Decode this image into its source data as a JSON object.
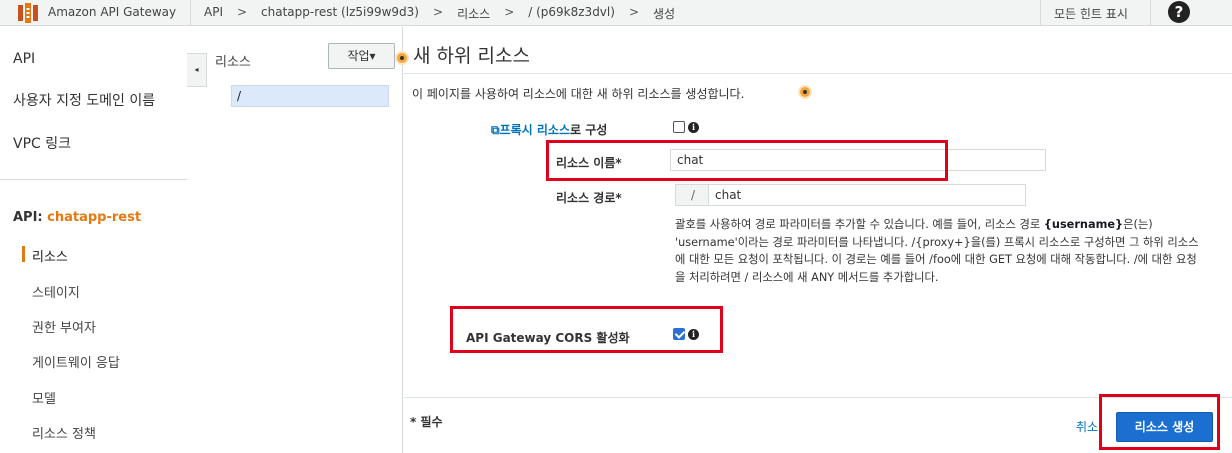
{
  "topbar": {
    "brand": "Amazon API Gateway",
    "breadcrumbs": [
      "API",
      "chatapp-rest (lz5i99w9d3)",
      "리소스",
      "/ (p69k8z3dvl)",
      "생성"
    ],
    "separator": ">",
    "hints_label": "모든 힌트 표시",
    "help_label": "?"
  },
  "leftnav": {
    "items": [
      "API",
      "사용자 지정 도메인 이름",
      "VPC 링크"
    ],
    "api_key": "API:",
    "api_name": "chatapp-rest",
    "sub_items": [
      "리소스",
      "스테이지",
      "권한 부여자",
      "게이트웨이 응답",
      "모델",
      "리소스 정책"
    ],
    "collapse_glyph": "◂"
  },
  "resources": {
    "title": "리소스",
    "action_label": "작업▾",
    "rows": [
      "/"
    ]
  },
  "main": {
    "title": "새 하위 리소스",
    "description": "이 페이지를 사용하여 리소스에 대한 새 하위 리소스를 생성합니다.",
    "proxy_link": "프록시 리소스",
    "proxy_rest": "로 구성",
    "proxy_checked": false,
    "name_label": "리소스 이름*",
    "name_value": "chat",
    "path_label": "리소스 경로*",
    "path_prefix": "/",
    "path_value": "chat",
    "help_before": "괄호를 사용하여 경로 파라미터를 추가할 수 있습니다. 예를 들어, 리소스 경로 ",
    "help_bold": "{username}",
    "help_after": "은(는) 'username'이라는 경로 파라미터를 나타냅니다. /{proxy+}을(를) 프록시 리소스로 구성하면 그 하위 리소스에 대한 모든 요청이 포착됩니다. 이 경로는 예를 들어 /foo에 대한 GET 요청에 대해 작동합니다. /에 대한 요청을 처리하려면 / 리소스에 새 ANY 메서드를 추가합니다.",
    "cors_label": "API Gateway CORS 활성화",
    "cors_checked": true,
    "required_note": "* 필수",
    "cancel_label": "취소",
    "create_label": "리소스 생성"
  },
  "colors": {
    "accent_orange": "#e47911",
    "link_blue": "#0073bb",
    "primary_button": "#1b6fd1",
    "highlight_red": "#e0001a"
  }
}
